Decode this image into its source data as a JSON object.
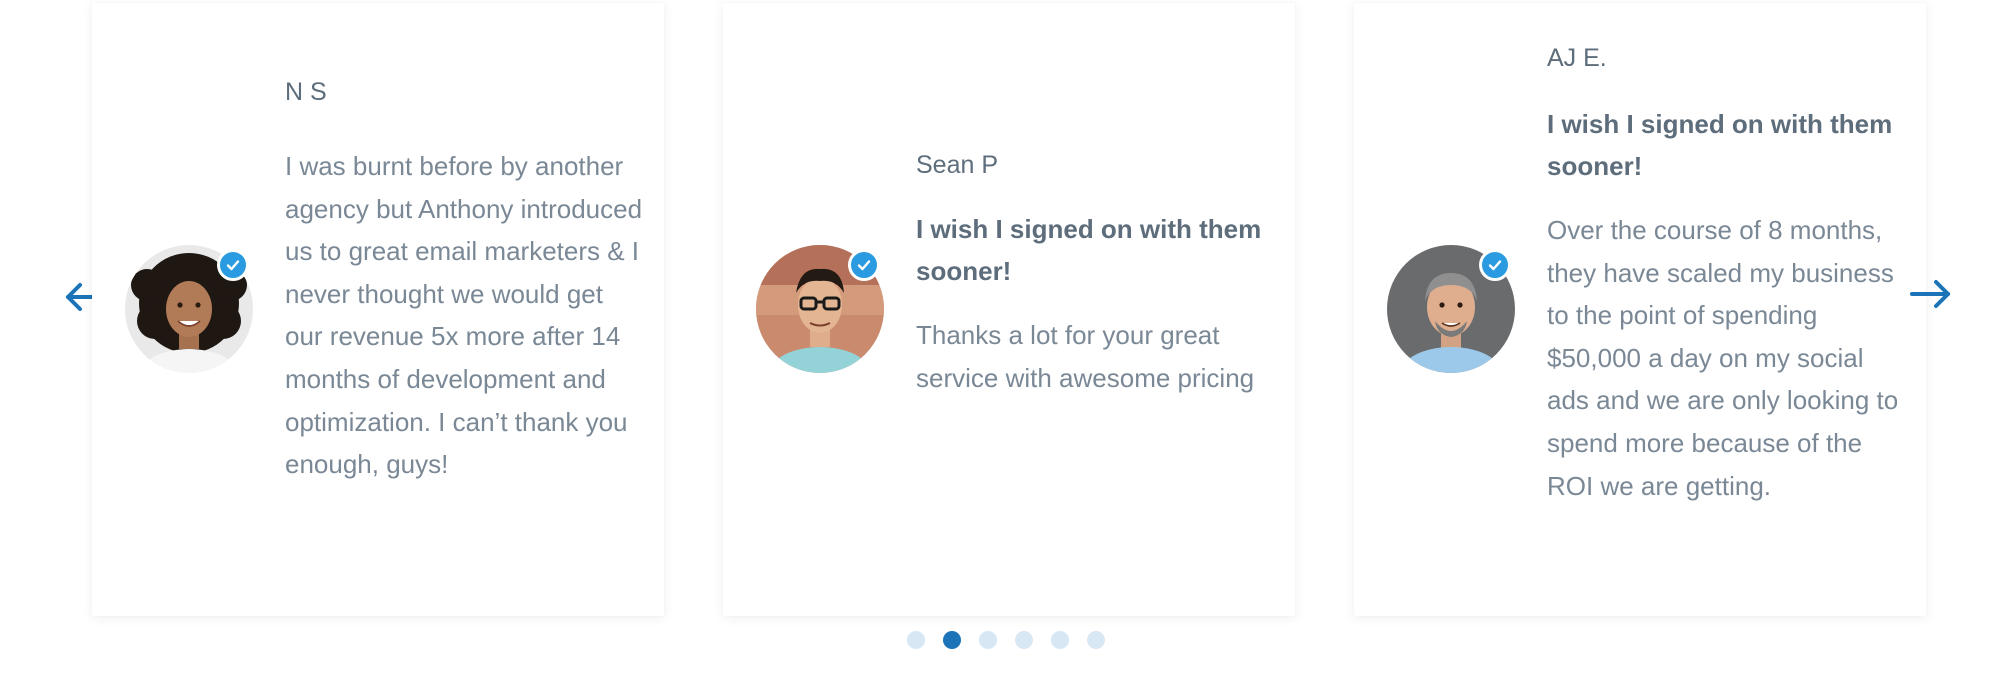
{
  "carousel": {
    "prev_icon": "arrow-left-icon",
    "next_icon": "arrow-right-icon",
    "accent_color": "#1b73b8",
    "dot_color": "#d8e7f4",
    "active_page": 2,
    "page_count": 6
  },
  "testimonials": [
    {
      "name": "N S",
      "headline": "",
      "text": "I was burnt before by another agency but Anthony introduced us to great email marketers & I never thought we would get our revenue 5x more after 14 months of development and optimization. I can’t thank you enough, guys!",
      "verified": true
    },
    {
      "name": "Sean P",
      "headline": "I wish I signed on with them sooner!",
      "text": "Thanks a lot for your great service with awesome pricing",
      "verified": true
    },
    {
      "name": "AJ E.",
      "headline": "I wish I signed on with them sooner!",
      "text": "Over the course of 8 months, they have scaled my business to the point of spending $50,000 a day on my social ads and we are only looking to spend more because of the ROI we are getting.",
      "verified": true
    }
  ]
}
